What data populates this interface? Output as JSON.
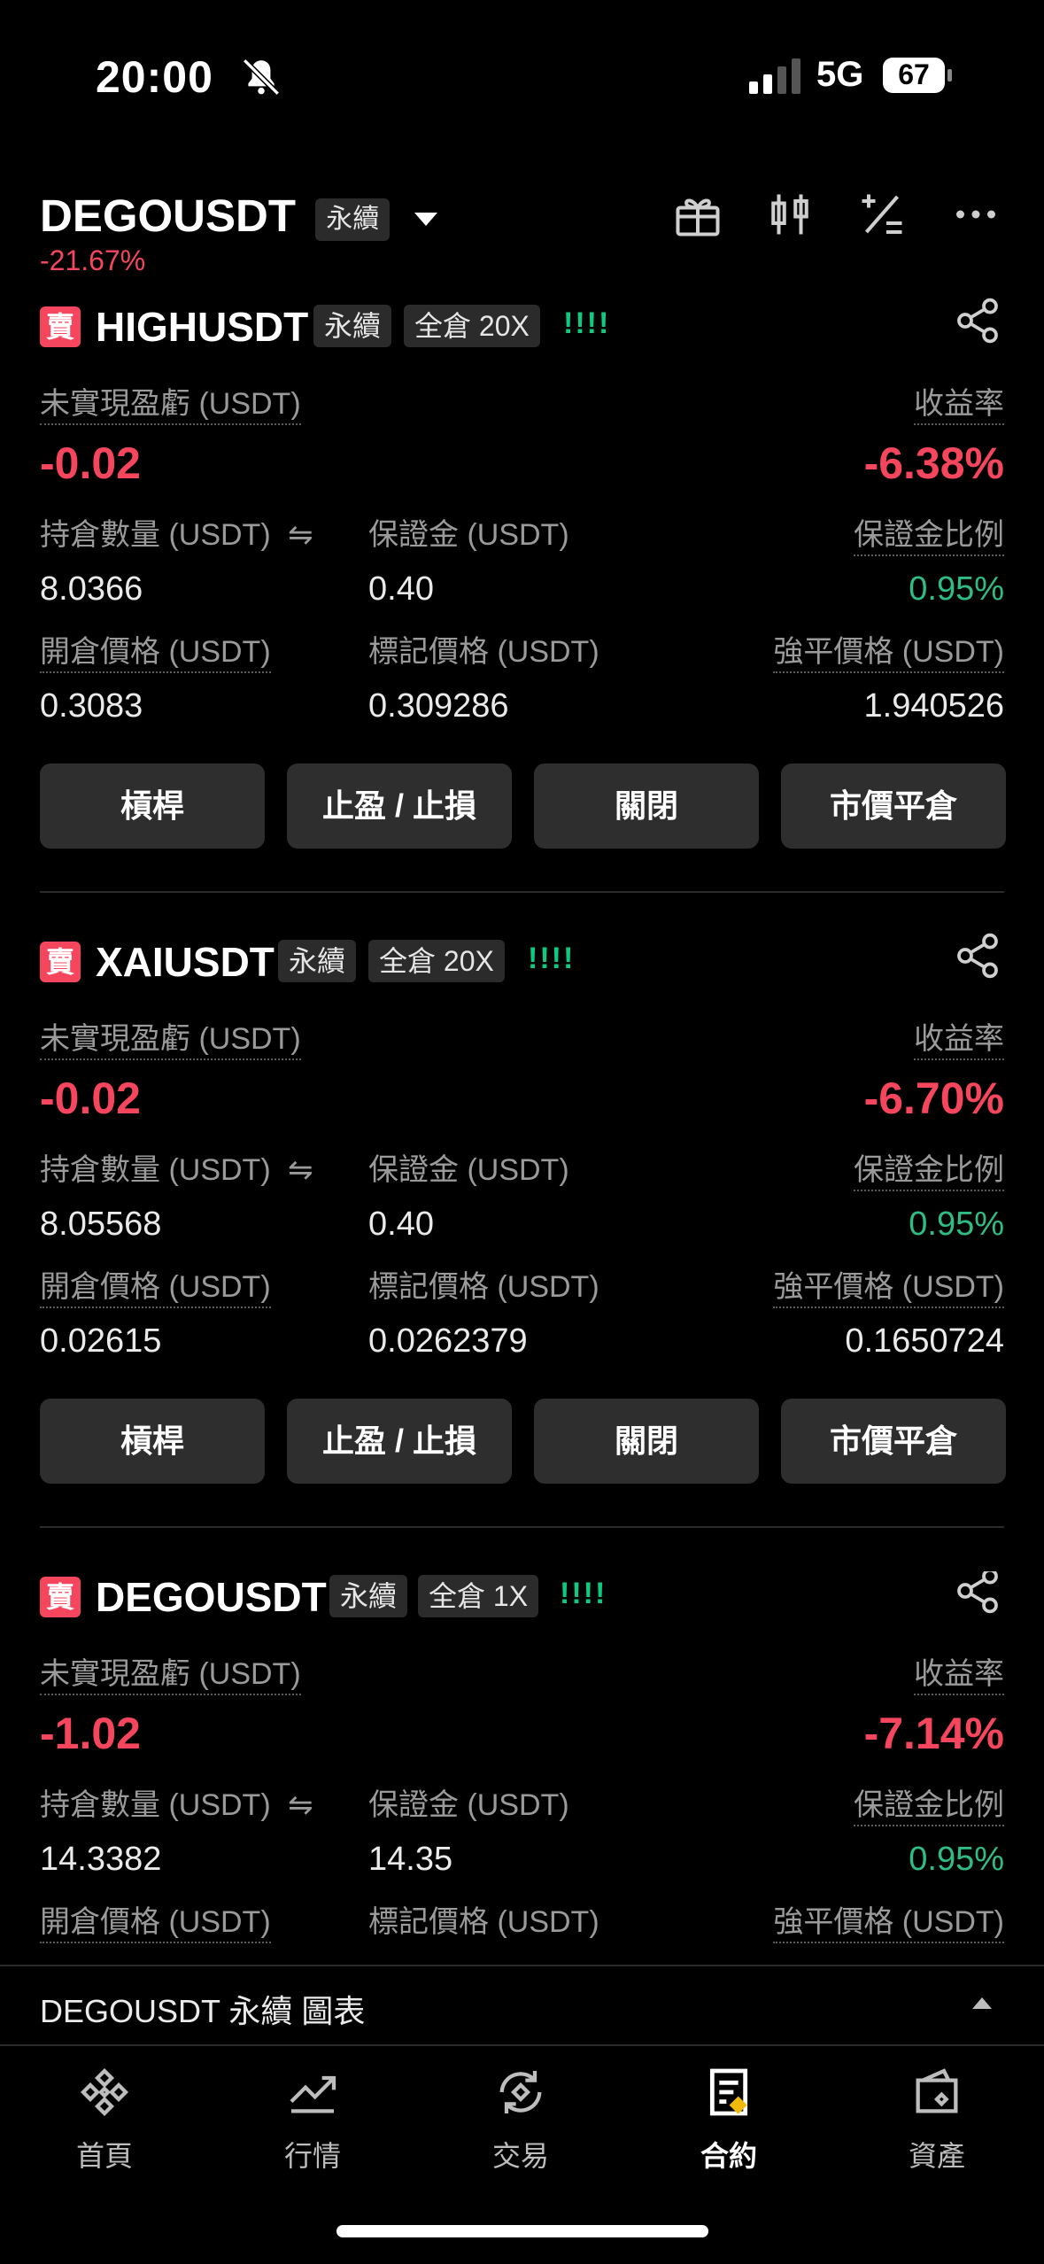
{
  "status_bar": {
    "time": "20:00",
    "network": "5G",
    "battery": "67"
  },
  "header": {
    "symbol": "DEGOUSDT",
    "type_tag": "永續",
    "change": "-21.67%"
  },
  "labels": {
    "unrealized_pnl": "未實現盈虧 (USDT)",
    "roi": "收益率",
    "position_size": "持倉數量 (USDT)",
    "margin": "保證金 (USDT)",
    "margin_ratio": "保證金比例",
    "entry_price": "開倉價格 (USDT)",
    "mark_price": "標記價格 (USDT)",
    "liq_price": "強平價格 (USDT)",
    "sell_badge": "賣"
  },
  "positions": [
    {
      "symbol": "HIGHUSDT",
      "type_tag": "永續",
      "mode_tag": "全倉 20X",
      "bars": "!!!!",
      "pnl": "-0.02",
      "roi": "-6.38%",
      "size": "8.0366",
      "margin": "0.40",
      "margin_ratio": "0.95%",
      "entry": "0.3083",
      "mark": "0.309286",
      "liq": "1.940526"
    },
    {
      "symbol": "XAIUSDT",
      "type_tag": "永續",
      "mode_tag": "全倉 20X",
      "bars": "!!!!",
      "pnl": "-0.02",
      "roi": "-6.70%",
      "size": "8.05568",
      "margin": "0.40",
      "margin_ratio": "0.95%",
      "entry": "0.02615",
      "mark": "0.0262379",
      "liq": "0.1650724"
    },
    {
      "symbol": "DEGOUSDT",
      "type_tag": "永續",
      "mode_tag": "全倉 1X",
      "bars": "!!!!",
      "pnl": "-1.02",
      "roi": "-7.14%",
      "size": "14.3382",
      "margin": "14.35",
      "margin_ratio": "0.95%"
    }
  ],
  "buttons": {
    "leverage": "槓桿",
    "tpsl": "止盈 / 止損",
    "close": "關閉",
    "market_close": "市價平倉"
  },
  "chart_bar": {
    "text": "DEGOUSDT 永續  圖表"
  },
  "tabs": [
    {
      "label": "首頁"
    },
    {
      "label": "行情"
    },
    {
      "label": "交易"
    },
    {
      "label": "合約"
    },
    {
      "label": "資產"
    }
  ]
}
